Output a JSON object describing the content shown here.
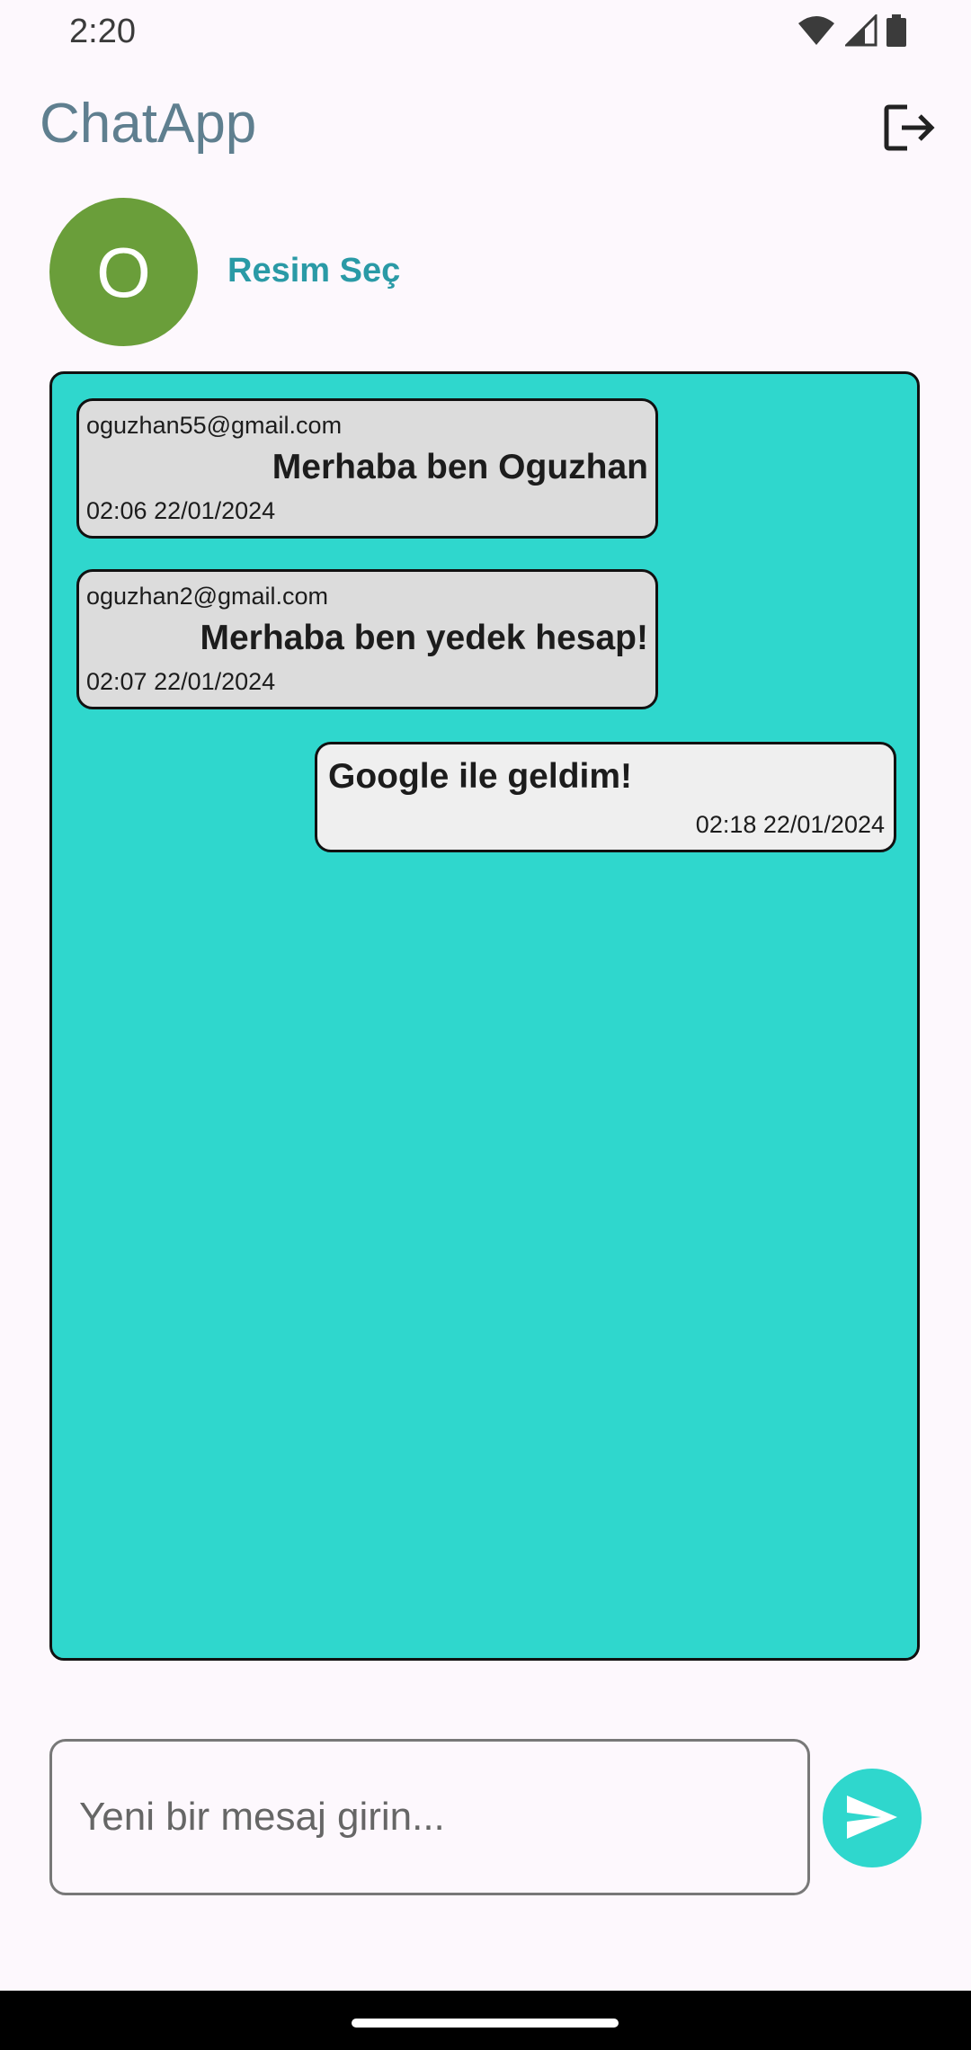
{
  "status_bar": {
    "time": "2:20",
    "icons": [
      "wifi-icon",
      "signal-icon",
      "battery-icon"
    ]
  },
  "app_bar": {
    "title": "ChatApp",
    "logout_icon": "logout-icon"
  },
  "profile": {
    "avatar_letter": "O",
    "avatar_color": "#6a9e3a",
    "pick_image_label": "Resim Seç"
  },
  "chat": {
    "background_color": "#2fd7cd",
    "messages": [
      {
        "sender": "oguzhan55@gmail.com",
        "text": "Merhaba ben Oguzhan",
        "time": "02:06 22/01/2024",
        "direction": "incoming"
      },
      {
        "sender": "oguzhan2@gmail.com",
        "text": "Merhaba ben yedek hesap!",
        "time": "02:07 22/01/2024",
        "direction": "incoming"
      },
      {
        "text": "Google ile geldim!",
        "time": "02:18 22/01/2024",
        "direction": "outgoing"
      }
    ]
  },
  "composer": {
    "placeholder": "Yeni bir mesaj girin...",
    "value": "",
    "send_icon": "send-icon"
  }
}
